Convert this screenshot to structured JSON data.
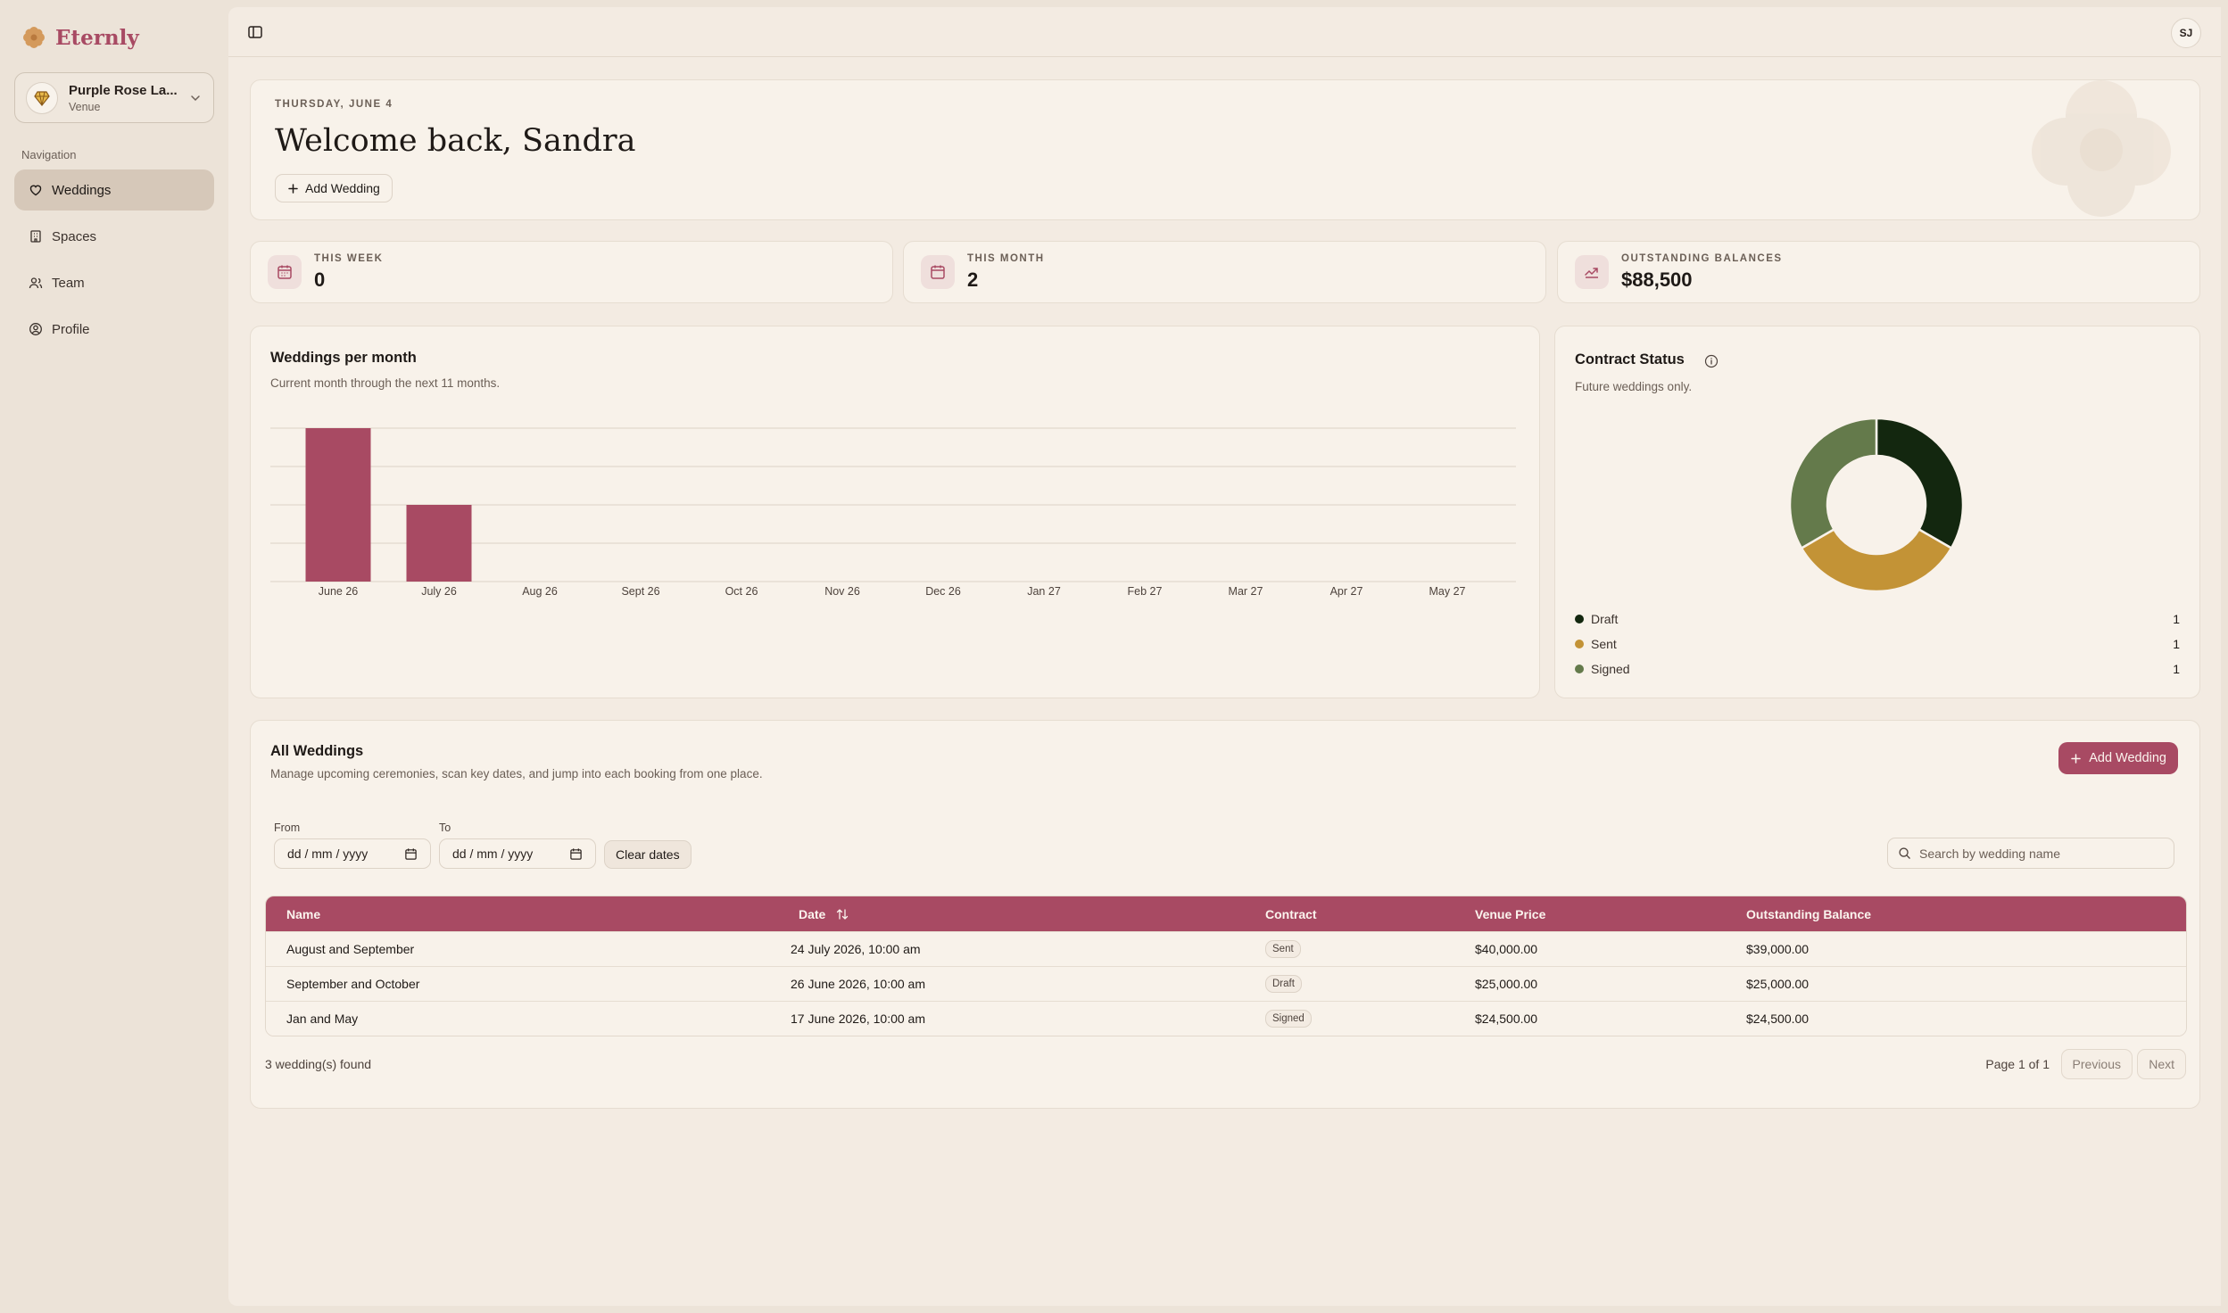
{
  "brand": {
    "name": "Eternly",
    "icon": "flower-logo"
  },
  "venue": {
    "name": "Purple Rose La...",
    "type": "Venue",
    "icon": "diamond-icon"
  },
  "navigation": {
    "label": "Navigation",
    "items": [
      {
        "label": "Weddings",
        "icon": "heart-icon",
        "active": true
      },
      {
        "label": "Spaces",
        "icon": "building-icon",
        "active": false
      },
      {
        "label": "Team",
        "icon": "users-icon",
        "active": false
      },
      {
        "label": "Profile",
        "icon": "user-circle-icon",
        "active": false
      }
    ]
  },
  "user": {
    "initials": "SJ"
  },
  "welcome": {
    "date": "THURSDAY, JUNE 4",
    "title": "Welcome back, Sandra",
    "add_button": "Add Wedding"
  },
  "stats": [
    {
      "label": "THIS WEEK",
      "value": "0",
      "icon": "calendar-icon"
    },
    {
      "label": "THIS MONTH",
      "value": "2",
      "icon": "calendar-icon"
    },
    {
      "label": "OUTSTANDING BALANCES",
      "value": "$88,500",
      "icon": "money-icon"
    }
  ],
  "weddings_chart": {
    "title": "Weddings per month",
    "subtitle": "Current month through the next 11 months."
  },
  "chart_data": {
    "type": "bar",
    "categories": [
      "June 26",
      "July 26",
      "Aug 26",
      "Sept 26",
      "Oct 26",
      "Nov 26",
      "Dec 26",
      "Jan 27",
      "Feb 27",
      "Mar 27",
      "Apr 27",
      "May 27"
    ],
    "values": [
      2,
      1,
      0,
      0,
      0,
      0,
      0,
      0,
      0,
      0,
      0,
      0
    ],
    "ylim": [
      0,
      2
    ],
    "grid": true,
    "color": "#a84a63"
  },
  "contract_status": {
    "title": "Contract Status",
    "subtitle": "Future weddings only.",
    "slices": [
      {
        "label": "Draft",
        "value": 1,
        "color": "#13270f"
      },
      {
        "label": "Sent",
        "value": 1,
        "color": "#c39336"
      },
      {
        "label": "Signed",
        "value": 1,
        "color": "#647a4b"
      }
    ]
  },
  "all_weddings": {
    "title": "All Weddings",
    "subtitle": "Manage upcoming ceremonies, scan key dates, and jump into each booking from one place.",
    "add_button": "Add Wedding",
    "from_label": "From",
    "to_label": "To",
    "from_value": "dd / mm / yyyy",
    "to_value": "dd / mm / yyyy",
    "clear_button": "Clear dates",
    "search_placeholder": "Search by wedding name",
    "columns": {
      "name": "Name",
      "date": "Date",
      "contract": "Contract",
      "venue_price": "Venue Price",
      "outstanding": "Outstanding Balance"
    },
    "rows": [
      {
        "name": "August and September",
        "date": "24 July 2026, 10:00 am",
        "contract": "Sent",
        "venue_price": "$40,000.00",
        "outstanding": "$39,000.00"
      },
      {
        "name": "September and October",
        "date": "26 June 2026, 10:00 am",
        "contract": "Draft",
        "venue_price": "$25,000.00",
        "outstanding": "$25,000.00"
      },
      {
        "name": "Jan and May",
        "date": "17 June 2026, 10:00 am",
        "contract": "Signed",
        "venue_price": "$24,500.00",
        "outstanding": "$24,500.00"
      }
    ],
    "count_text": "3 wedding(s) found",
    "page_text": "Page 1 of 1",
    "previous": "Previous",
    "next": "Next"
  }
}
